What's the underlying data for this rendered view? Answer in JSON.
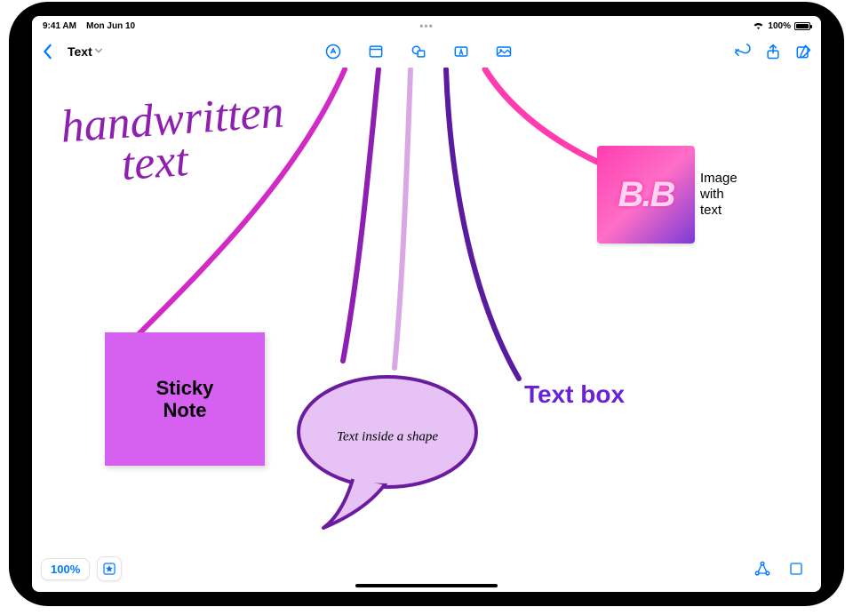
{
  "status": {
    "time": "9:41 AM",
    "date": "Mon Jun 10",
    "battery_pct": "100%"
  },
  "toolbar": {
    "doc_title": "Text"
  },
  "canvas": {
    "handwritten": "handwritten\n     text",
    "sticky_note": "Sticky\nNote",
    "shape_text": "Text inside a shape",
    "text_box": "Text box",
    "image_text": "B.B",
    "image_caption": "Image\nwith\ntext"
  },
  "bottom": {
    "zoom": "100%"
  },
  "colors": {
    "accent": "#007aff",
    "stroke_magenta": "#d22bc5",
    "stroke_purple": "#8e1fb0",
    "stroke_lilac": "#d9a7e6",
    "stroke_violet": "#5a1c9e",
    "stroke_pink": "#ff3db0",
    "sticky_bg": "#d661f0",
    "textbox_purple": "#6a22d8"
  }
}
